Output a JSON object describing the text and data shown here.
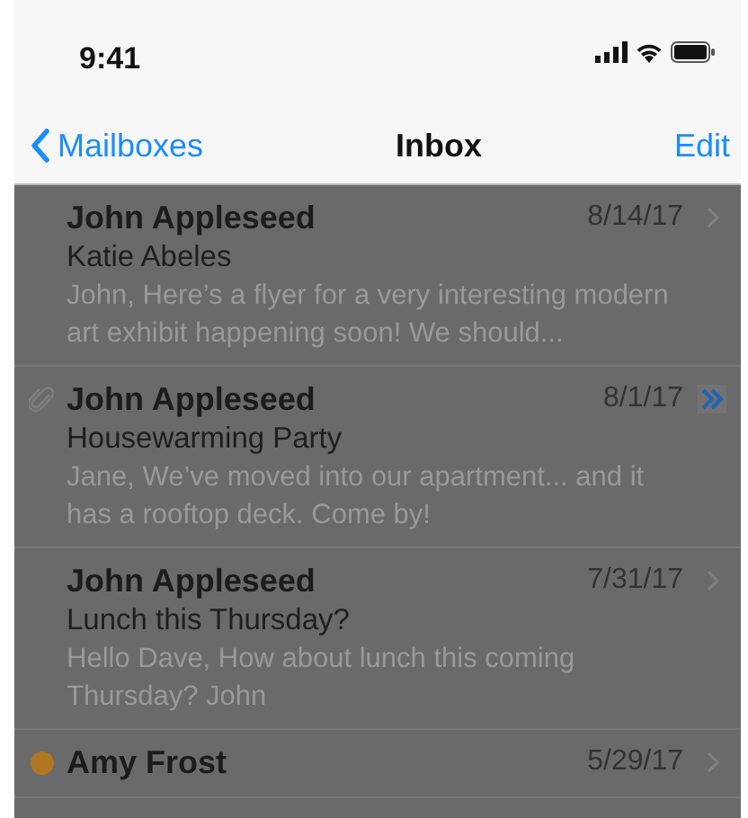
{
  "status_bar": {
    "time": "9:41"
  },
  "nav": {
    "back": "Mailboxes",
    "title": "Inbox",
    "action": "Edit"
  },
  "messages": [
    {
      "sender": "John Appleseed",
      "date": "8/14/17",
      "subject": "Katie Abeles",
      "preview": "John, Here’s a flyer for a very interesting modern art exhibit happening soon! We should...",
      "attachment": false,
      "thread": false,
      "flagged": false
    },
    {
      "sender": "John Appleseed",
      "date": "8/1/17",
      "subject": "Housewarming Party",
      "preview": "Jane, We’ve moved into our apartment... and it has a rooftop deck. Come by!",
      "attachment": true,
      "thread": true,
      "flagged": false
    },
    {
      "sender": "John Appleseed",
      "date": "7/31/17",
      "subject": "Lunch this Thursday?",
      "preview": "Hello Dave, How about lunch this coming Thursday? John",
      "attachment": false,
      "thread": false,
      "flagged": false
    },
    {
      "sender": "Amy Frost",
      "date": "5/29/17",
      "attachment": false,
      "thread": false,
      "flagged": true
    }
  ]
}
